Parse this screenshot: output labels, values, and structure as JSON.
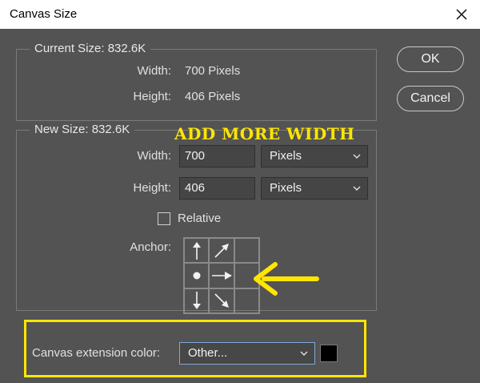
{
  "window": {
    "title": "Canvas Size"
  },
  "current_size": {
    "legend": "Current Size: 832.6K",
    "width_label": "Width:",
    "width_value": "700 Pixels",
    "height_label": "Height:",
    "height_value": "406 Pixels"
  },
  "new_size": {
    "legend": "New Size: 832.6K",
    "width_label": "Width:",
    "width_value": "700",
    "width_unit": "Pixels",
    "height_label": "Height:",
    "height_value": "406",
    "height_unit": "Pixels",
    "relative_label": "Relative",
    "relative_checked": false,
    "anchor_label": "Anchor:"
  },
  "extension": {
    "label": "Canvas extension color:",
    "value": "Other...",
    "swatch_color": "#000000"
  },
  "buttons": {
    "ok": "OK",
    "cancel": "Cancel"
  },
  "annotation": {
    "text": "ADD MORE WIDTH",
    "color": "#ffe600"
  },
  "anchor_icons": [
    "arrow-up-icon",
    "arrow-up-right-icon",
    "",
    "anchor-dot-icon",
    "arrow-right-icon",
    "",
    "arrow-down-icon",
    "arrow-down-right-icon",
    ""
  ]
}
